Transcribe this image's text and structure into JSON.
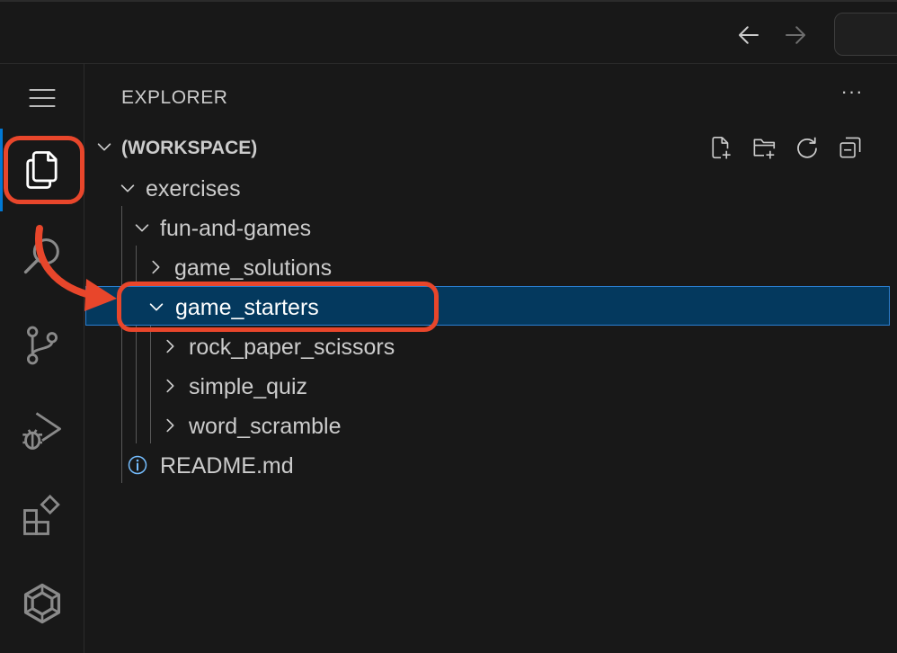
{
  "titlebar": {
    "back_icon": "arrow-left-icon",
    "forward_icon": "arrow-right-icon"
  },
  "activity_bar": {
    "items": [
      {
        "name": "explorer",
        "icon": "files-icon",
        "active": true
      },
      {
        "name": "search",
        "icon": "search-icon"
      },
      {
        "name": "source-control",
        "icon": "source-control-icon"
      },
      {
        "name": "run-and-debug",
        "icon": "run-debug-icon"
      },
      {
        "name": "extensions",
        "icon": "extensions-icon"
      },
      {
        "name": "codespaces",
        "icon": "hexagon-icon"
      }
    ]
  },
  "sidebar": {
    "title": "EXPLORER",
    "more": "···",
    "workspace": {
      "label": "(WORKSPACE)",
      "actions": [
        "new-file-icon",
        "new-folder-icon",
        "refresh-icon",
        "collapse-all-icon"
      ]
    },
    "tree": [
      {
        "label": "exercises",
        "type": "folder",
        "expanded": true,
        "depth": 1
      },
      {
        "label": "fun-and-games",
        "type": "folder",
        "expanded": true,
        "depth": 2
      },
      {
        "label": "game_solutions",
        "type": "folder",
        "expanded": false,
        "depth": 3
      },
      {
        "label": "game_starters",
        "type": "folder",
        "expanded": true,
        "depth": 3,
        "selected": true
      },
      {
        "label": "rock_paper_scissors",
        "type": "folder",
        "expanded": false,
        "depth": 4
      },
      {
        "label": "simple_quiz",
        "type": "folder",
        "expanded": false,
        "depth": 4
      },
      {
        "label": "word_scramble",
        "type": "folder",
        "expanded": false,
        "depth": 4
      },
      {
        "label": "README.md",
        "type": "file",
        "icon": "info-icon",
        "depth": 2
      }
    ]
  },
  "annotation": {
    "color": "#e8462b"
  },
  "colors": {
    "accent": "#0078d4",
    "selection": "#04395e",
    "info": "#75beff"
  }
}
